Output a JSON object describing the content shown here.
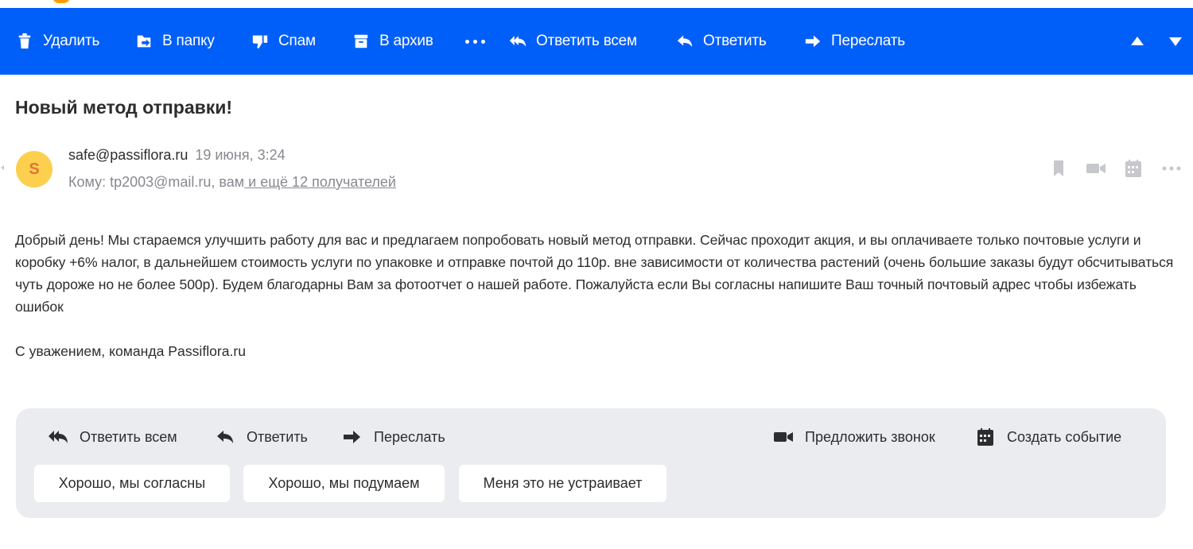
{
  "toolbar": {
    "delete_label": "Удалить",
    "to_folder_label": "В папку",
    "spam_label": "Спам",
    "archive_label": "В архив",
    "reply_all_label": "Ответить всем",
    "reply_label": "Ответить",
    "forward_label": "Переслать",
    "bg_color": "#005ff9"
  },
  "message": {
    "subject": "Новый метод отправки!",
    "avatar_letter": "S",
    "sender_email": "safe@passiflora.ru",
    "date": "19 июня, 3:24",
    "to_prefix": "Кому: tp2003@mail.ru, вам",
    "to_more": " и ещё 12 получателей",
    "body": "Добрый день! Мы стараемся улучшить работу для вас и предлагаем попробовать новый метод отправки. Сейчас проходит акция, и вы оплачиваете только почтовые услуги и коробку +6% налог, в дальнейшем стоимость услуги по упаковке и отправке почтой до 110р. вне зависимости от количества растений (очень большие заказы будут обсчитываться чуть дороже но не более 500р). Будем благодарны Вам за фотоотчет о нашей работе. Пожалуйста если Вы согласны напишите Ваш точный почтовый адрес чтобы избежать ошибок",
    "signature": "С уважением, команда Passiflora.ru"
  },
  "reply_panel": {
    "reply_all_label": "Ответить всем",
    "reply_label": "Ответить",
    "forward_label": "Переслать",
    "call_label": "Предложить звонок",
    "event_label": "Создать событие",
    "quick_replies": [
      "Хорошо, мы согласны",
      "Хорошо, мы подумаем",
      "Меня это не устраивает"
    ]
  }
}
